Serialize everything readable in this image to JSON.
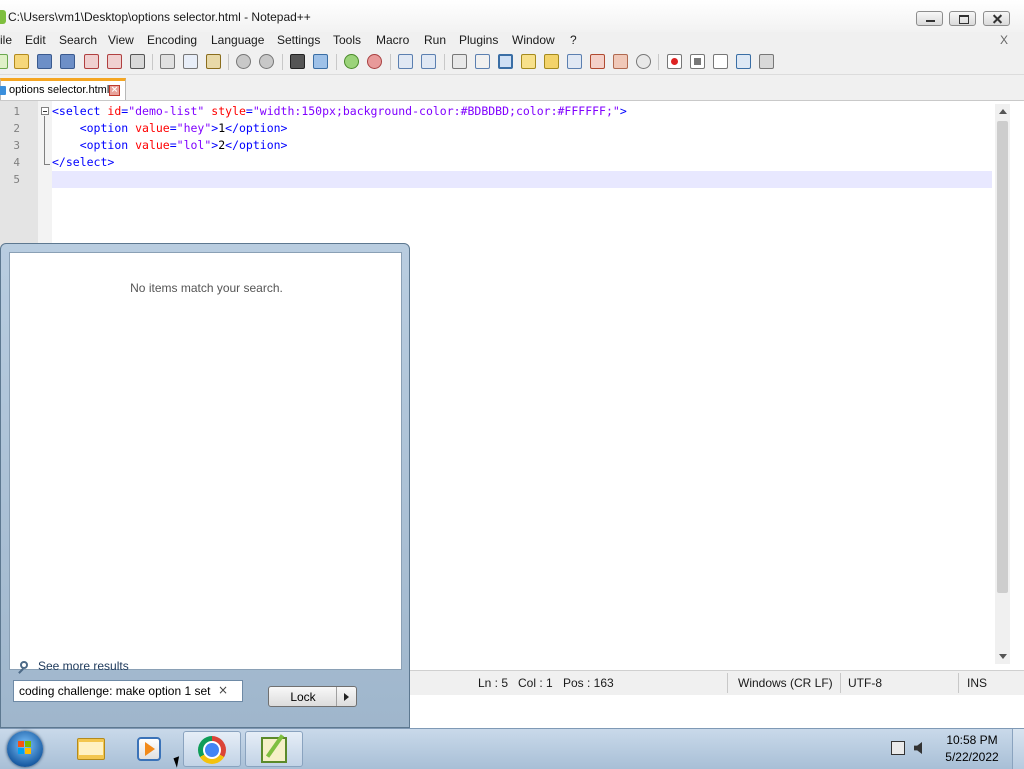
{
  "window": {
    "title": "C:\\Users\\vm1\\Desktop\\options selector.html - Notepad++"
  },
  "menubar": {
    "items": [
      "ile",
      "Edit",
      "Search",
      "View",
      "Encoding",
      "Language",
      "Settings",
      "Tools",
      "Macro",
      "Run",
      "Plugins",
      "Window",
      "?"
    ],
    "close_label": "X"
  },
  "tab": {
    "label": "options selector.html"
  },
  "editor": {
    "line_numbers": [
      "1",
      "2",
      "3",
      "4",
      "5"
    ],
    "lines": [
      [
        {
          "t": "tag",
          "v": "<select "
        },
        {
          "t": "attr",
          "v": "id"
        },
        {
          "t": "tag",
          "v": "="
        },
        {
          "t": "str",
          "v": "\"demo-list\""
        },
        {
          "t": "tag",
          "v": " "
        },
        {
          "t": "attr",
          "v": "style"
        },
        {
          "t": "tag",
          "v": "="
        },
        {
          "t": "str",
          "v": "\"width:150px;background-color:#BDBDBD;color:#FFFFFF;\""
        },
        {
          "t": "tag",
          "v": ">"
        }
      ],
      [
        {
          "t": "txt",
          "v": "    "
        },
        {
          "t": "tag",
          "v": "<option "
        },
        {
          "t": "attr",
          "v": "value"
        },
        {
          "t": "tag",
          "v": "="
        },
        {
          "t": "str",
          "v": "\"hey\""
        },
        {
          "t": "tag",
          "v": ">"
        },
        {
          "t": "txt",
          "v": "1"
        },
        {
          "t": "tag",
          "v": "</option>"
        }
      ],
      [
        {
          "t": "txt",
          "v": "    "
        },
        {
          "t": "tag",
          "v": "<option "
        },
        {
          "t": "attr",
          "v": "value"
        },
        {
          "t": "tag",
          "v": "="
        },
        {
          "t": "str",
          "v": "\"lol\""
        },
        {
          "t": "tag",
          "v": ">"
        },
        {
          "t": "txt",
          "v": "2"
        },
        {
          "t": "tag",
          "v": "</option>"
        }
      ],
      [
        {
          "t": "tag",
          "v": "</select>"
        }
      ],
      []
    ]
  },
  "statusbar": {
    "ln": "Ln : 5",
    "col": "Col : 1",
    "pos": "Pos : 163",
    "eol": "Windows (CR LF)",
    "encoding": "UTF-8",
    "mode": "INS"
  },
  "start_menu": {
    "no_items_text": "No items match your search.",
    "see_more_label": "See more results",
    "search_value": "coding challenge: make option 1 set",
    "search_clear": "×",
    "lock_label": "Lock"
  },
  "taskbar": {
    "time": "10:58 PM",
    "date": "5/22/2022"
  },
  "colors": {
    "tag": "#0000ff",
    "attr": "#ff0000",
    "string": "#8000ff",
    "current_line": "#e8e8ff",
    "tab_accent": "#f5a623"
  }
}
